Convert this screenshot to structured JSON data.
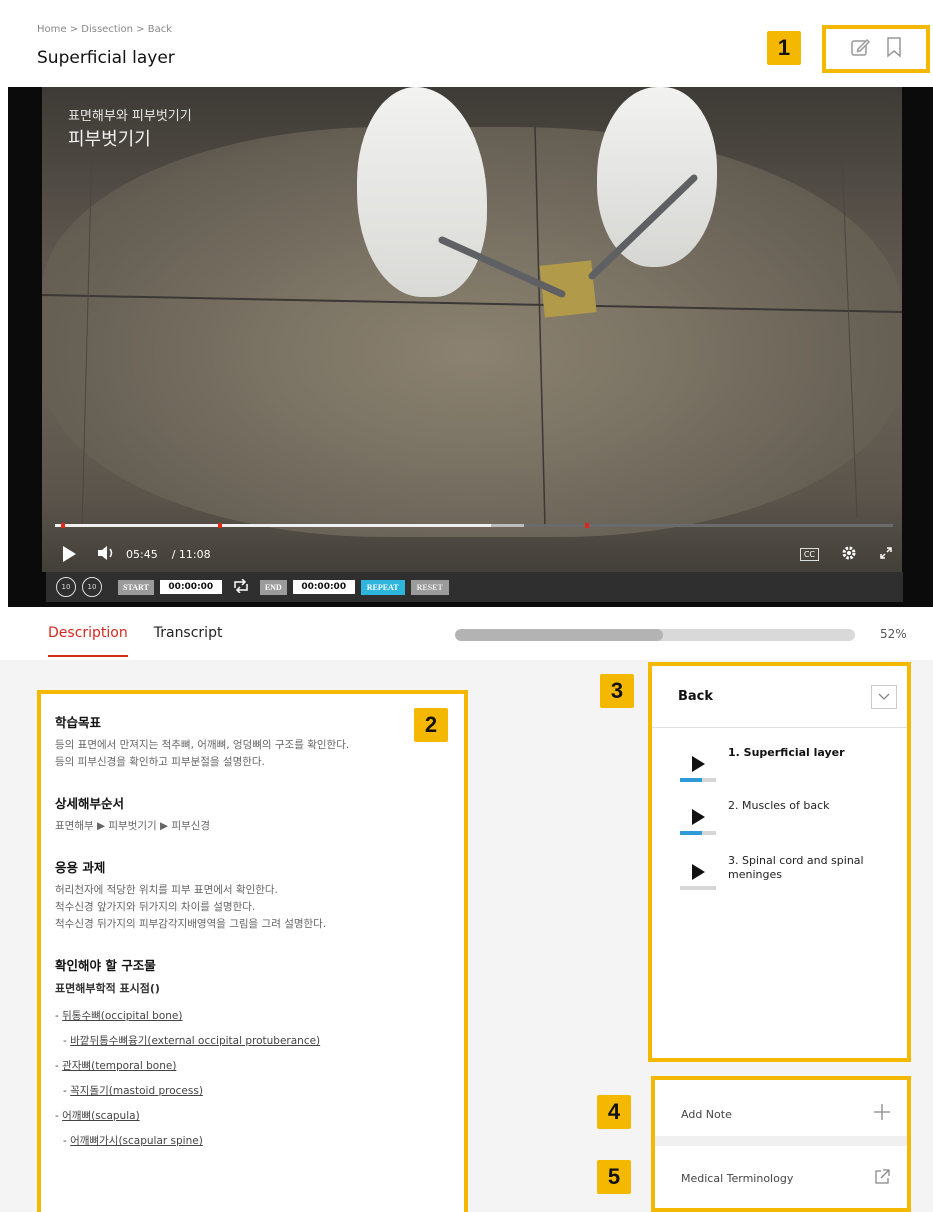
{
  "header": {
    "breadcrumb": "Home > Dissection > Back",
    "title": "Superficial layer",
    "icons": [
      "edit-icon",
      "bookmark-icon"
    ]
  },
  "callouts": [
    "1",
    "2",
    "3",
    "4",
    "5"
  ],
  "video": {
    "overlay_line1": "표면해부와 피부벗기기",
    "overlay_line2": "피부벗기기",
    "current_time": "05:45",
    "duration": "/ 11:08",
    "progress": 0.52,
    "buffered": 0.56,
    "cc_label": "CC",
    "toolbar": {
      "start_label": "START",
      "start_value": "00:00:00",
      "end_label": "END",
      "end_value": "00:00:00",
      "repeat_label": "REPEAT",
      "reset_label": "RESET",
      "rewind_label": "10",
      "forward_label": "10"
    }
  },
  "tabs": [
    {
      "label": "Description",
      "active": true
    },
    {
      "label": "Transcript",
      "active": false
    }
  ],
  "course_progress": {
    "value": 0.52,
    "label": "52%"
  },
  "description": {
    "sections": [
      {
        "heading": "학습목표",
        "lines": [
          "등의 표면에서 만져지는 척추뼈, 어깨뼈, 엉덩뼈의 구조를 확인한다.",
          "등의 피부신경을 확인하고 피부분절을 설명한다."
        ]
      },
      {
        "heading": "상세해부순서",
        "lines": [
          "표면해부 ▶ 피부벗기기 ▶ 피부신경"
        ]
      },
      {
        "heading": "응용 과제",
        "lines": [
          "허리천자에 적당한 위치를 피부 표면에서 확인한다.",
          "척수신경 앞가지와 뒤가지의 차이를 설명한다.",
          "척수신경 뒤가지의 피부감각지배영역을 그림을 그려 설명한다."
        ]
      }
    ],
    "structures_heading": "확인해야 할 구조물",
    "structures_sub": "표면해부학적 표시점()",
    "structures": [
      {
        "prefix": "- ",
        "text": "뒤통수뼈(occipital bone)",
        "indent": false
      },
      {
        "prefix": "- ",
        "text": "바깥뒤통수뼈융기(external occipital protuberance)",
        "indent": true
      },
      {
        "prefix": "- ",
        "text": "관자뼈(temporal bone)",
        "indent": false
      },
      {
        "prefix": "- ",
        "text": "꼭지돌기(mastoid process)",
        "indent": true
      },
      {
        "prefix": "- ",
        "text": "어깨뼈(scapula)",
        "indent": false
      },
      {
        "prefix": "- ",
        "text": "어깨뼈가시(scapular spine)",
        "indent": true
      }
    ]
  },
  "playlist": {
    "title": "Back",
    "items": [
      {
        "label": "1.  Superficial layer",
        "current": true,
        "progress": 0.6
      },
      {
        "label": "2.  Muscles of back",
        "current": false,
        "progress": 0.6
      },
      {
        "label": "3.  Spinal cord and spinal meninges",
        "current": false,
        "progress": 0
      }
    ]
  },
  "side": {
    "add_note": "Add Note",
    "medical_terminology": "Medical Terminology"
  }
}
